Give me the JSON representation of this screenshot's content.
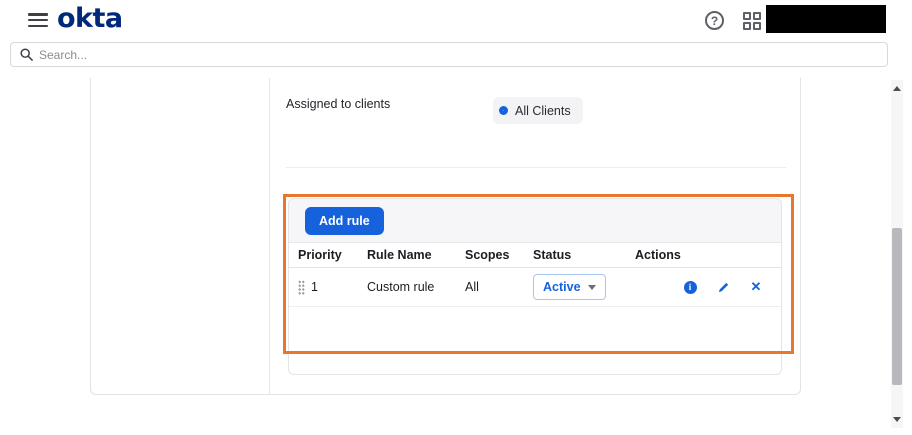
{
  "header": {
    "logo_text": "okta"
  },
  "search": {
    "placeholder": "Search..."
  },
  "content": {
    "assigned_to_clients_label": "Assigned to clients",
    "all_clients_pill": "All Clients"
  },
  "rules_table": {
    "add_rule_button": "Add rule",
    "columns": [
      "Priority",
      "Rule Name",
      "Scopes",
      "Status",
      "Actions"
    ],
    "rows": [
      {
        "priority": "1",
        "rule_name": "Custom rule",
        "scopes": "All",
        "status": "Active"
      }
    ]
  },
  "icons": {
    "help": "?",
    "info": "i",
    "delete": "✕"
  },
  "colors": {
    "brand_blue": "#1662dd",
    "logo_navy": "#00297a",
    "highlight_orange": "#e8762c",
    "table_header_bg": "#f6f6f8"
  }
}
